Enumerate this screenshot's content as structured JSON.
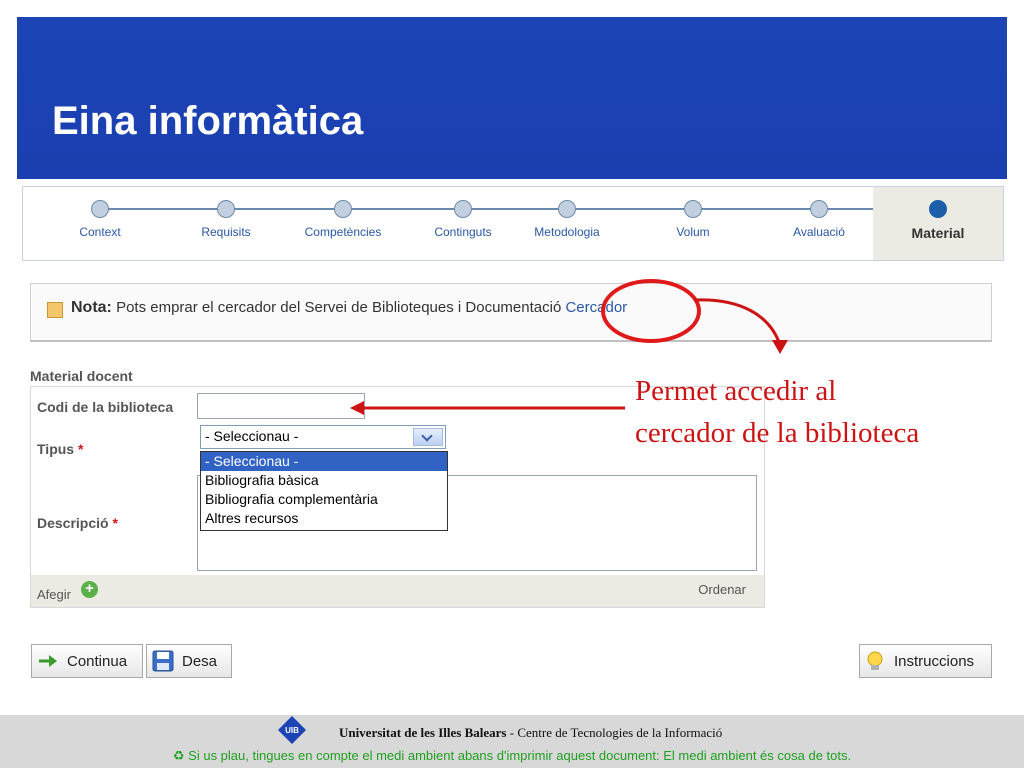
{
  "title": "Eina informàtica",
  "steps": [
    {
      "label": "Context"
    },
    {
      "label": "Requisits"
    },
    {
      "label": "Competències"
    },
    {
      "label": "Continguts"
    },
    {
      "label": "Metodologia"
    },
    {
      "label": "Volum"
    },
    {
      "label": "Avaluació"
    },
    {
      "label": "Material"
    }
  ],
  "active_step": "Material",
  "note": {
    "label": "Nota:",
    "text": "Pots emprar el cercador del Servei de Biblioteques i Documentació",
    "link": "Cercador"
  },
  "section_title": "Material docent",
  "form": {
    "codi_label": "Codi de la biblioteca",
    "codi_value": "",
    "tipus_label": "Tipus",
    "descripcio_label": "Descripció",
    "required_mark": "*",
    "tipus_selected": "- Seleccionau -",
    "tipus_options": [
      "- Seleccionau -",
      "Bibliografia bàsica",
      "Bibliografia complementària",
      "Altres recursos"
    ],
    "add_label": "Afegir",
    "order_label": "Ordenar"
  },
  "annotation": {
    "line1": "Permet accedir al",
    "line2": "cercador de la biblioteca"
  },
  "buttons": {
    "continue": "Continua",
    "save": "Desa",
    "instructions": "Instruccions"
  },
  "footer": {
    "logo_text": "UIB",
    "university": "Universitat de les Illes Balears",
    "centre": "- Centre de Tecnologies de la Informació",
    "eco_note": "Si us plau, tingues en compte el medi ambient abans d'imprimir aquest document: El medi ambient és cosa de tots."
  },
  "colors": {
    "banner": "#1c44b4",
    "annotation": "#cc1414",
    "link": "#2a58a6",
    "eco": "#1fa01f"
  }
}
